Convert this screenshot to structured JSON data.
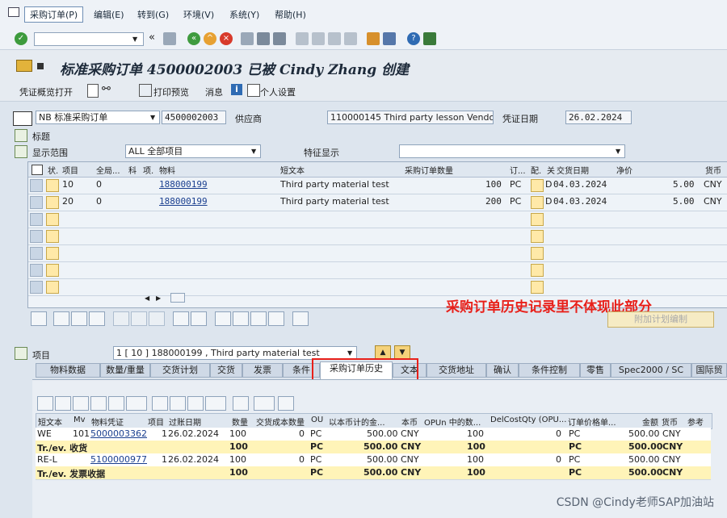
{
  "menu": [
    "采购订单(P)",
    "编辑(E)",
    "转到(G)",
    "环境(V)",
    "系统(Y)",
    "帮助(H)"
  ],
  "title": "标准采购订单 4500002003 已被 Cindy Zhang 创建",
  "app_toolbar": [
    "凭证概览打开",
    "打印预览",
    "消息",
    "个人设置"
  ],
  "header": {
    "doc_type": "NB 标准采购订单",
    "po_number": "4500002003",
    "vendor_label": "供应商",
    "vendor": "110000145 Third party lesson Vendor",
    "doc_date_label": "凭证日期",
    "doc_date": "26.02.2024"
  },
  "section_header_label": "标题",
  "display": {
    "label": "显示范围",
    "value": "ALL 全部项目",
    "char_label": "特征显示",
    "char_value": ""
  },
  "items_table": {
    "columns": [
      "状.",
      "项目",
      "全局...",
      "科",
      "项.",
      "物料",
      "短文本",
      "采购订单数量",
      "订...",
      "配.",
      "关",
      "交货日期",
      "净价",
      "货币"
    ],
    "rows": [
      {
        "item": "10",
        "global": "0",
        "material": "188000199",
        "short_text": "Third party material test",
        "qty": "100",
        "unit": "PC",
        "d": "D",
        "date": "04.03.2024",
        "price": "5.00",
        "curr": "CNY"
      },
      {
        "item": "20",
        "global": "0",
        "material": "188000199",
        "short_text": "Third party material test",
        "qty": "200",
        "unit": "PC",
        "d": "D",
        "date": "04.03.2024",
        "price": "5.00",
        "curr": "CNY"
      }
    ]
  },
  "annotation": "采购订单历史记录里不体现此部分",
  "add_plan_button": "附加计划编制",
  "item_detail": {
    "label": "项目",
    "value": "1 [ 10 ] 188000199 , Third party material test"
  },
  "tabs": [
    "物料数据",
    "数量/重量",
    "交货计划",
    "交货",
    "发票",
    "条件",
    "采购订单历史",
    "文本",
    "交货地址",
    "确认",
    "条件控制",
    "零售",
    "Spec2000 / SC",
    "国际贸"
  ],
  "active_tab": "采购订单历史",
  "history": {
    "columns": [
      "短文本",
      "Mv",
      "物料凭证",
      "项目",
      "过账日期",
      "数量",
      "交货成本数量",
      "OU",
      "以本币计的金...",
      "本币",
      "OPUn 中的数...",
      "DelCostQty (OPU...",
      "订单价格单...",
      "金额",
      "货币",
      "参考"
    ],
    "rows": [
      {
        "type": "item",
        "short": "WE",
        "mv": "101",
        "doc": "5000003362",
        "item": "1",
        "date": "26.02.2024",
        "qty": "100",
        "dcq": "0",
        "ou": "PC",
        "lc_amt": "500.00",
        "lc": "CNY",
        "opun": "100",
        "delcost": "0",
        "opu": "PC",
        "amt": "500.00",
        "curr": "CNY"
      },
      {
        "type": "sum",
        "short": "Tr./ev. 收货",
        "qty": "100",
        "ou": "PC",
        "lc_amt": "500.00",
        "lc": "CNY",
        "opun": "100",
        "opu": "PC",
        "amt": "500.00",
        "curr": "CNY"
      },
      {
        "type": "item",
        "short": "RE-L",
        "mv": "",
        "doc": "5100000977",
        "item": "1",
        "date": "26.02.2024",
        "qty": "100",
        "dcq": "0",
        "ou": "PC",
        "lc_amt": "500.00",
        "lc": "CNY",
        "opun": "100",
        "delcost": "0",
        "opu": "PC",
        "amt": "500.00",
        "curr": "CNY"
      },
      {
        "type": "sum",
        "short": "Tr./ev. 发票收据",
        "qty": "100",
        "ou": "PC",
        "lc_amt": "500.00",
        "lc": "CNY",
        "opun": "100",
        "opu": "PC",
        "amt": "500.00",
        "curr": "CNY"
      }
    ]
  },
  "watermark": "CSDN @Cindy老师SAP加油站"
}
